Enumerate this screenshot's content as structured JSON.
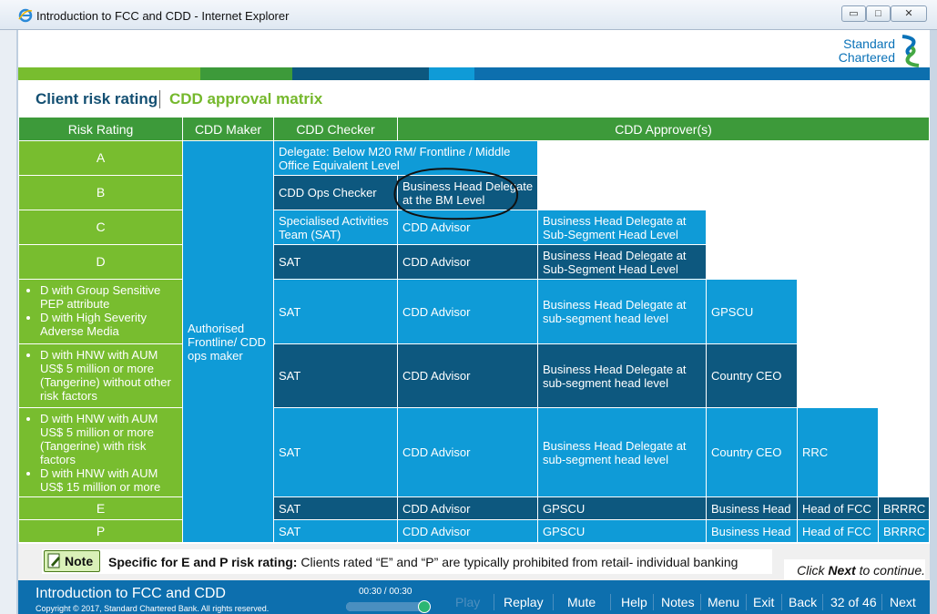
{
  "window": {
    "title": "Introduction to FCC and CDD - Internet Explorer",
    "controls": {
      "minimize": "▭",
      "maximize": "□",
      "close": "✕"
    }
  },
  "brand": {
    "line1": "Standard",
    "line2": "Chartered"
  },
  "header": {
    "title": "Client risk rating",
    "subtitle": "CDD approval matrix"
  },
  "colors": {
    "green_header": "#3d9a3a",
    "lime": "#78bd2f",
    "light_blue": "#0f9bd7",
    "dark_blue": "#0d587f",
    "footer_blue": "#0d6fae"
  },
  "matrix": {
    "headers": {
      "risk": "Risk Rating",
      "maker": "CDD Maker",
      "checker": "CDD Checker",
      "approvers": "CDD Approver(s)"
    },
    "ratings": [
      "A",
      "B",
      "C",
      "D",
      "E",
      "P"
    ],
    "maker_value": "Authorised Frontline/ CDD ops maker",
    "group_sensitive": [
      "D with Group Sensitive PEP attribute",
      "D with High Severity Adverse Media"
    ],
    "hnw_5m": [
      "D with HNW with AUM US$ 5 million or more (Tangerine) without other risk factors"
    ],
    "hnw_risk": [
      "D with HNW with AUM US$ 5 million or more (Tangerine) with risk factors",
      "D with HNW with AUM US$ 15 million or more"
    ],
    "row_a": {
      "checker": "Delegate: Below M20 RM/ Frontline / Middle Office Equivalent Level"
    },
    "row_b": {
      "checker": "CDD Ops Checker",
      "approver1": "Business Head Delegate at the BM Level"
    },
    "row_c": {
      "checker": "Specialised Activities Team (SAT)",
      "approver1": "CDD Advisor",
      "approver2": "Business Head Delegate at Sub-Segment Head Level"
    },
    "row_d": {
      "checker": "SAT",
      "approver1": "CDD Advisor",
      "approver2": "Business Head Delegate at Sub-Segment Head Level"
    },
    "row_pep": {
      "checker": "SAT",
      "approver1": "CDD Advisor",
      "approver2": "Business Head Delegate at sub-segment head level",
      "approver3": "GPSCU"
    },
    "row_hnw": {
      "checker": "SAT",
      "approver1": "CDD Advisor",
      "approver2": "Business Head Delegate at sub-segment head level",
      "approver3": "Country CEO"
    },
    "row_hnwr": {
      "checker": "SAT",
      "approver1": "CDD Advisor",
      "approver2": "Business Head Delegate at sub-segment head level",
      "approver3": "Country CEO",
      "approver4": "RRC"
    },
    "row_e": {
      "checker": "SAT",
      "approver1": "CDD Advisor",
      "approver2": "GPSCU",
      "approver3": "Business Head",
      "approver4": "Head of FCC",
      "approver5": "BRRRC"
    },
    "row_p": {
      "checker": "SAT",
      "approver1": "CDD Advisor",
      "approver2": "GPSCU",
      "approver3": "Business Head",
      "approver4": "Head of FCC",
      "approver5": "BRRRC"
    }
  },
  "note": {
    "label": "Note",
    "bold": "Specific for E and P risk rating:",
    "text": " Clients rated “E” and “P” are typically prohibited from retail- individual banking"
  },
  "continue": {
    "pre": "Click ",
    "bold": "Next",
    "post": " to continue."
  },
  "footer": {
    "course_title": "Introduction to FCC and CDD",
    "copyright": "Copyright © 2017, Standard Chartered Bank. All rights reserved.",
    "time": "00:30 / 00:30",
    "progress": 1.0,
    "nav": {
      "play": "Play",
      "replay": "Replay",
      "mute": "Mute",
      "help": "Help",
      "notes": "Notes",
      "menu": "Menu",
      "exit": "Exit",
      "back": "Back",
      "page": "32 of 46",
      "next": "Next"
    }
  }
}
